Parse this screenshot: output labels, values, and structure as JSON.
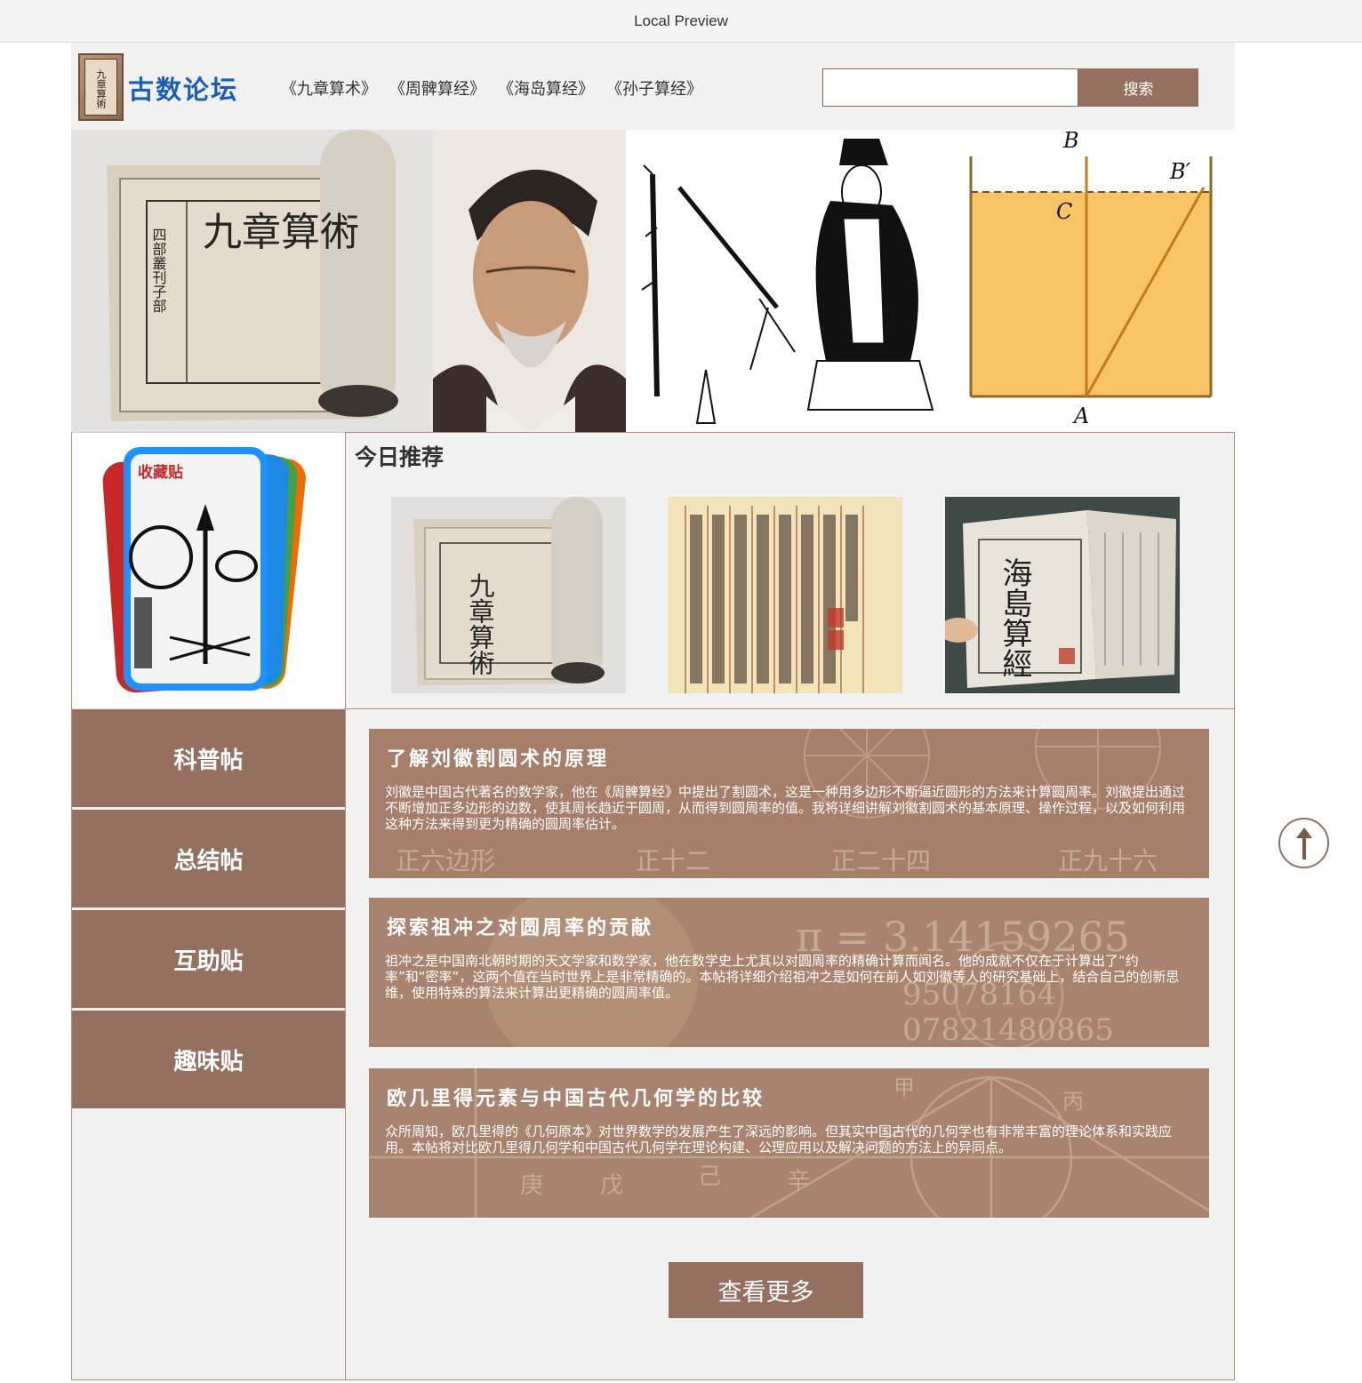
{
  "browser": {
    "title": "Local Preview"
  },
  "header": {
    "logo_text": "九章算術",
    "site_title": "古数论坛",
    "nav": [
      "《九章算术》",
      "《周髀算经》",
      "《海岛算经》",
      "《孙子算经》"
    ],
    "search": {
      "placeholder": "",
      "button_label": "搜索"
    }
  },
  "banner": {
    "images": [
      "jiuzhang-book",
      "liu-hui-portrait",
      "sage-with-bamboo",
      "water-pool-diagram"
    ],
    "diagram_labels": {
      "b": "B",
      "b_prime": "B′",
      "c": "C",
      "a": "A"
    }
  },
  "sidebar": {
    "card_label": "收藏贴",
    "categories": [
      "科普帖",
      "总结帖",
      "互助贴",
      "趣味贴"
    ]
  },
  "recommend": {
    "title": "今日推荐",
    "books": [
      "jiuzhang-suanshu",
      "zhoubi-suanjing",
      "haidao-suanjing"
    ],
    "book_texts": {
      "jiuzhang": "九章算術",
      "jiuzhang_side": "四部叢刊子部",
      "haidao": "海島算經"
    }
  },
  "posts": [
    {
      "title": "了解刘徽割圆术的原理",
      "body": "刘徽是中国古代著名的数学家，他在《周髀算经》中提出了割圆术，这是一种用多边形不断逼近圆形的方法来计算圆周率。刘徽提出通过不断增加正多边形的边数，使其周长趋近于圆周，从而得到圆周率的值。我将详细讲解刘徽割圆术的基本原理、操作过程，以及如何利用这种方法来得到更为精确的圆周率估计。",
      "bg_text": [
        "正六边形",
        "正十二",
        "正二十四",
        "正九十六"
      ]
    },
    {
      "title": "探索祖冲之对圆周率的贡献",
      "body": "祖冲之是中国南北朝时期的天文学家和数学家，他在数学史上尤其以对圆周率的精确计算而闻名。他的成就不仅在于计算出了“约率”和“密率”，这两个值在当时世界上是非常精确的。本帖将详细介绍祖冲之是如何在前人如刘徽等人的研究基础上，结合自己的创新思维，使用特殊的算法来计算出更精确的圆周率值。",
      "bg_text": [
        "π = 3.14159265",
        "95078164",
        "07821480865"
      ]
    },
    {
      "title": "欧几里得元素与中国古代几何学的比较",
      "body": "众所周知，欧几里得的《几何原本》对世界数学的发展产生了深远的影响。但其实中国古代的几何学也有非常丰富的理论体系和实践应用。本帖将对比欧几里得几何学和中国古代几何学在理论构建、公理应用以及解决问题的方法上的异同点。",
      "bg_text": [
        "甲",
        "丙",
        "庚",
        "戊",
        "己",
        "辛"
      ]
    }
  ],
  "more_button": "查看更多",
  "back_to_top": "arrow-up-icon",
  "colors": {
    "accent": "#957060",
    "title_blue": "#1a5fb6",
    "panel": "#f1f1f1"
  }
}
